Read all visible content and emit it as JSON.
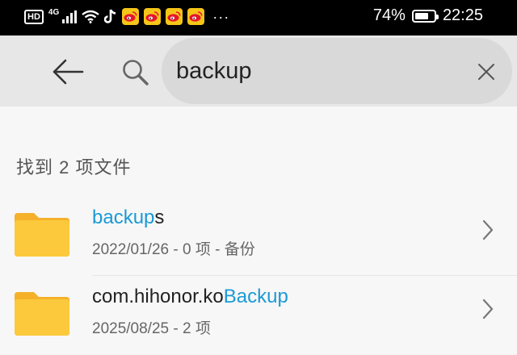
{
  "status_bar": {
    "hd": "HD",
    "network": "4G",
    "battery_percent": "74%",
    "time": "22:25",
    "battery_level": 0.74
  },
  "search": {
    "back_icon": "arrow-left-icon",
    "search_icon": "magnifier-icon",
    "query": "backup",
    "clear_icon": "close-icon"
  },
  "results": {
    "count_label": "找到 2 项文件",
    "items": [
      {
        "name_before": "",
        "name_match": "backup",
        "name_after": "s",
        "meta": "2022/01/26 - 0 项 - 备份"
      },
      {
        "name_before": "com.hihonor.ko",
        "name_match": "Backup",
        "name_after": "",
        "meta": "2025/08/25 - 2 项"
      }
    ]
  },
  "colors": {
    "highlight": "#1a9ad6",
    "folder": "#fcc93d",
    "folder_tab": "#f5b12a"
  }
}
